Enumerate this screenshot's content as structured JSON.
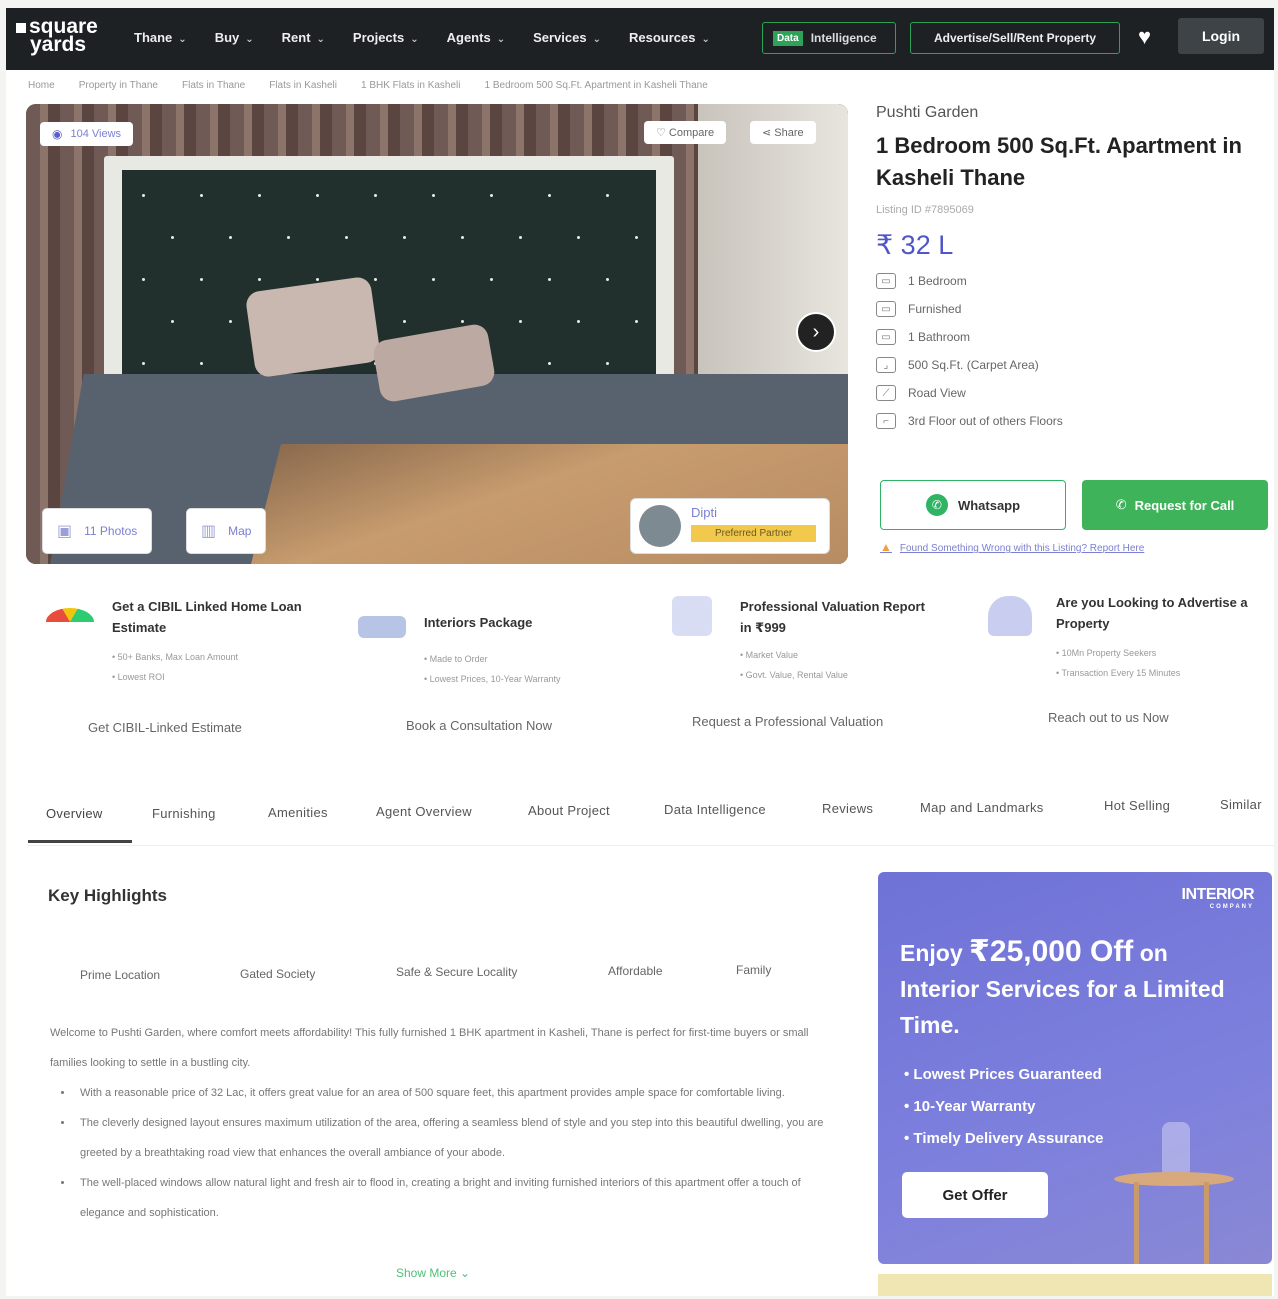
{
  "header": {
    "logo_line1": "square",
    "logo_line2": "yards",
    "nav": [
      "Thane",
      "Buy",
      "Rent",
      "Projects",
      "Agents",
      "Services",
      "Resources"
    ],
    "data_intel_badge": "Data",
    "data_intel_label": "Intelligence",
    "advertise_label": "Advertise/Sell/Rent Property",
    "login_label": "Login"
  },
  "breadcrumb": [
    "Home",
    "Property in Thane",
    "Flats in Thane",
    "Flats in Kasheli",
    "1 BHK Flats in Kasheli",
    "1 Bedroom 500 Sq.Ft. Apartment in Kasheli Thane"
  ],
  "gallery": {
    "views": "104 Views",
    "compare": "Compare",
    "share": "Share",
    "photos": "11 Photos",
    "map": "Map",
    "agent_name": "Dipti",
    "agent_badge": "Preferred Partner"
  },
  "property": {
    "project": "Pushti Garden",
    "title": "1 Bedroom 500 Sq.Ft. Apartment in Kasheli Thane",
    "listing_id": "Listing ID #7895069",
    "price": "₹ 32 L",
    "features": [
      {
        "icon": "bed-icon",
        "label": "1 Bedroom"
      },
      {
        "icon": "sofa-icon",
        "label": "Furnished"
      },
      {
        "icon": "bath-icon",
        "label": "1 Bathroom"
      },
      {
        "icon": "area-icon",
        "label": "500 Sq.Ft. (Carpet Area)"
      },
      {
        "icon": "road-icon",
        "label": "Road View"
      },
      {
        "icon": "stairs-icon",
        "label": "3rd Floor out of others Floors"
      }
    ],
    "whatsapp": "Whatsapp",
    "call": "Request for Call",
    "report": "Found Something Wrong with this Listing? Report Here"
  },
  "services": [
    {
      "title": "Get a CIBIL Linked Home Loan Estimate",
      "bullets": [
        "50+ Banks, Max Loan Amount",
        "Lowest ROI"
      ],
      "link": "Get CIBIL-Linked Estimate"
    },
    {
      "title": "Interiors Package",
      "bullets": [
        "Made to Order",
        "Lowest Prices, 10-Year Warranty"
      ],
      "link": "Book a Consultation Now"
    },
    {
      "title": "Professional Valuation Report in ₹999",
      "bullets": [
        "Market Value",
        "Govt. Value, Rental Value"
      ],
      "link": "Request a Professional Valuation"
    },
    {
      "title": "Are you Looking to Advertise a Property",
      "bullets": [
        "10Mn Property Seekers",
        "Transaction Every 15 Minutes"
      ],
      "link": "Reach out to us Now"
    }
  ],
  "tabs": [
    "Overview",
    "Furnishing",
    "Amenities",
    "Agent Overview",
    "About Project",
    "Data Intelligence",
    "Reviews",
    "Map and Landmarks",
    "Hot Selling",
    "Similar"
  ],
  "highlights": {
    "title": "Key Highlights",
    "chips": [
      "Prime Location",
      "Gated Society",
      "Safe & Secure Locality",
      "Affordable",
      "Family"
    ],
    "intro": "Welcome to Pushti Garden, where comfort meets affordability! This fully furnished 1 BHK apartment in Kasheli, Thane is perfect for first-time buyers or small families looking to settle in a bustling city.",
    "bullets": [
      "With a reasonable price of 32 Lac, it offers great value for an area of 500 square feet, this apartment provides ample space for comfortable living.",
      "The cleverly designed layout ensures maximum utilization of the area, offering a seamless blend of style and you step into this beautiful dwelling, you are greeted by a breathtaking road view that enhances the overall ambiance of your abode.",
      "The well-placed windows allow natural light and fresh air to flood in, creating a bright and inviting furnished interiors of this apartment offer a touch of elegance and sophistication."
    ],
    "show_more": "Show More"
  },
  "ad": {
    "brand": "INTERIOR",
    "brand_sub": "COMPANY",
    "enjoy": "Enjoy",
    "amount": "₹25,000 Off",
    "on": "on",
    "headline_rest": "Interior Services for a Limited Time.",
    "bullets": [
      "Lowest Prices Guaranteed",
      "10-Year Warranty",
      "Timely Delivery Assurance"
    ],
    "cta": "Get Offer"
  }
}
